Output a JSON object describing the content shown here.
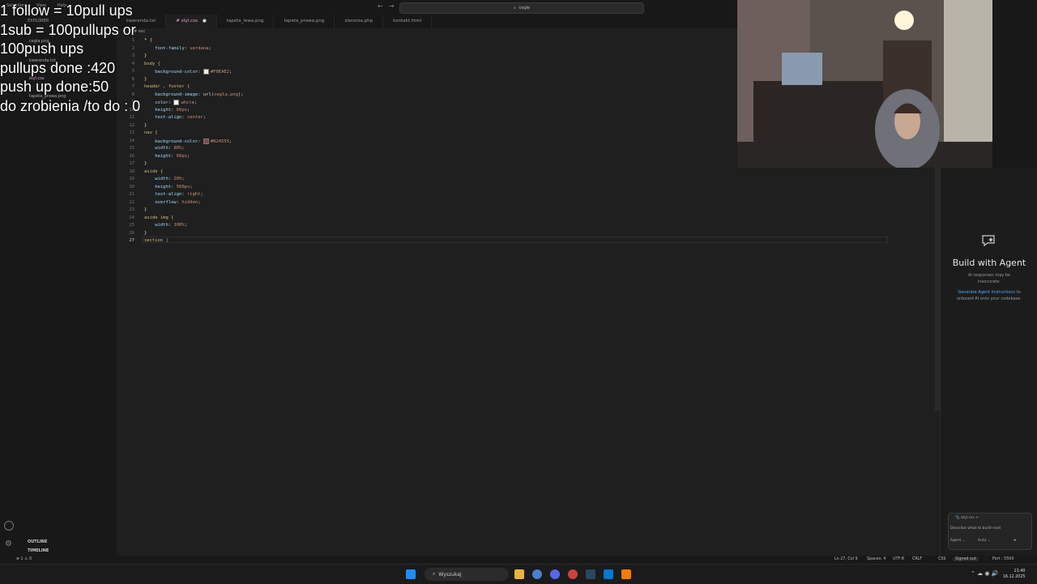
{
  "overlay": {
    "lines": [
      "1 follow = 10pull ups",
      "1sub = 100pullups or",
      "100push ups",
      "pullups done :420",
      "push up done:50",
      "do zrobienia /to do : 0"
    ]
  },
  "titlebar": {
    "search": "cegle",
    "menu": [
      "Selection",
      "View",
      "Help"
    ]
  },
  "sidebar": {
    "title": "EXPLORER",
    "items": [
      "cegla.png",
      "kwerenda.txt",
      "styl.css",
      "tapeta_prawa.png"
    ],
    "outline": "OUTLINE",
    "timeline": "TIMELINE"
  },
  "tabs": [
    {
      "label": "kwerenda.txt"
    },
    {
      "label": "# styl.css",
      "dirty": "●"
    },
    {
      "label": "tapeta_lewa.png"
    },
    {
      "label": "tapeta_prawa.png"
    },
    {
      "label": "zlecenia.php"
    },
    {
      "label": "kontakt.html"
    }
  ],
  "breadcrumb": "# sec",
  "editor": {
    "lines": [
      {
        "n": "1",
        "parts": [
          {
            "t": "* {",
            "c": "br"
          }
        ]
      },
      {
        "n": "2",
        "parts": [
          {
            "t": "    font-family",
            "c": "prop"
          },
          {
            "t": ": ",
            "c": ""
          },
          {
            "t": "verdana",
            "c": "val"
          },
          {
            "t": ";",
            "c": ""
          }
        ]
      },
      {
        "n": "3",
        "parts": [
          {
            "t": "}",
            "c": "br"
          }
        ]
      },
      {
        "n": "4",
        "parts": [
          {
            "t": "body {",
            "c": "sel"
          }
        ]
      },
      {
        "n": "5",
        "parts": [
          {
            "t": "    background-color",
            "c": "prop"
          },
          {
            "t": ": ",
            "c": ""
          },
          {
            "sw": "#F0EAE2"
          },
          {
            "t": "#F0EAE2",
            "c": "val"
          },
          {
            "t": ";",
            "c": ""
          }
        ]
      },
      {
        "n": "6",
        "parts": [
          {
            "t": "}",
            "c": "br"
          }
        ]
      },
      {
        "n": "7",
        "parts": [
          {
            "t": "header , footer {",
            "c": "sel"
          }
        ]
      },
      {
        "n": "8",
        "parts": [
          {
            "t": "    background-image",
            "c": "prop"
          },
          {
            "t": ": url(",
            "c": ""
          },
          {
            "t": "cegla.png",
            "c": "val"
          },
          {
            "t": ");",
            "c": ""
          }
        ]
      },
      {
        "n": "9",
        "parts": [
          {
            "t": "    color",
            "c": "prop"
          },
          {
            "t": ": ",
            "c": ""
          },
          {
            "sw": "#ffffff"
          },
          {
            "t": "white",
            "c": "val"
          },
          {
            "t": ";",
            "c": ""
          }
        ]
      },
      {
        "n": "10",
        "parts": [
          {
            "t": "    height",
            "c": "prop"
          },
          {
            "t": ": ",
            "c": ""
          },
          {
            "t": "60px",
            "c": "val"
          },
          {
            "t": ";",
            "c": ""
          }
        ]
      },
      {
        "n": "11",
        "parts": [
          {
            "t": "    text-align",
            "c": "prop"
          },
          {
            "t": ": ",
            "c": ""
          },
          {
            "t": "center",
            "c": "val"
          },
          {
            "t": ";",
            "c": ""
          }
        ]
      },
      {
        "n": "12",
        "parts": [
          {
            "t": "}",
            "c": "br"
          }
        ]
      },
      {
        "n": "13",
        "parts": [
          {
            "t": "nav {",
            "c": "sel"
          }
        ]
      },
      {
        "n": "14",
        "parts": [
          {
            "t": "    background-color",
            "c": "prop"
          },
          {
            "t": ": ",
            "c": ""
          },
          {
            "sw": "#824555"
          },
          {
            "t": "#824555",
            "c": "val"
          },
          {
            "t": ";",
            "c": ""
          }
        ]
      },
      {
        "n": "15",
        "parts": [
          {
            "t": "    width",
            "c": "prop"
          },
          {
            "t": ": ",
            "c": ""
          },
          {
            "t": "80%",
            "c": "val"
          },
          {
            "t": ";",
            "c": ""
          }
        ]
      },
      {
        "n": "16",
        "parts": [
          {
            "t": "    height",
            "c": "prop"
          },
          {
            "t": ": ",
            "c": ""
          },
          {
            "t": "60px",
            "c": "val"
          },
          {
            "t": ";",
            "c": ""
          }
        ]
      },
      {
        "n": "17",
        "parts": [
          {
            "t": "}",
            "c": "br"
          }
        ]
      },
      {
        "n": "18",
        "parts": [
          {
            "t": "aside {",
            "c": "sel"
          }
        ]
      },
      {
        "n": "19",
        "parts": [
          {
            "t": "    width",
            "c": "prop"
          },
          {
            "t": ": ",
            "c": ""
          },
          {
            "t": "20%",
            "c": "val"
          },
          {
            "t": ";",
            "c": ""
          }
        ]
      },
      {
        "n": "20",
        "parts": [
          {
            "t": "    height",
            "c": "prop"
          },
          {
            "t": ": ",
            "c": ""
          },
          {
            "t": "560px",
            "c": "val"
          },
          {
            "t": ";",
            "c": ""
          }
        ]
      },
      {
        "n": "21",
        "parts": [
          {
            "t": "    text-align",
            "c": "prop"
          },
          {
            "t": ": ",
            "c": ""
          },
          {
            "t": "right",
            "c": "val"
          },
          {
            "t": ";",
            "c": ""
          }
        ]
      },
      {
        "n": "22",
        "parts": [
          {
            "t": "    overflow",
            "c": "prop"
          },
          {
            "t": ": ",
            "c": ""
          },
          {
            "t": "hidden",
            "c": "val"
          },
          {
            "t": ";",
            "c": ""
          }
        ]
      },
      {
        "n": "23",
        "parts": [
          {
            "t": "}",
            "c": "br"
          }
        ]
      },
      {
        "n": "24",
        "parts": [
          {
            "t": "aside img {",
            "c": "sel"
          }
        ]
      },
      {
        "n": "25",
        "parts": [
          {
            "t": "    width",
            "c": "prop"
          },
          {
            "t": ": ",
            "c": ""
          },
          {
            "t": "100%",
            "c": "val"
          },
          {
            "t": ";",
            "c": ""
          }
        ]
      },
      {
        "n": "26",
        "parts": [
          {
            "t": "}",
            "c": "br"
          }
        ]
      },
      {
        "n": "27",
        "parts": [
          {
            "t": "section |",
            "c": "sel"
          }
        ]
      }
    ]
  },
  "agent": {
    "title": "Build with Agent",
    "sub1": "AI responses may be",
    "sub2": "inaccurate.",
    "link": "Generate Agent Instructions",
    "link_suffix": "to",
    "line3": "onboard AI onto your codebase.",
    "chat_file": "styl.css",
    "chat_placeholder": "Describe what to build next",
    "chat_mode": "Agent",
    "chat_model": "Auto"
  },
  "statusbar": {
    "left": "⊗ 1 ⚠ 0",
    "position": "Ln 27, Col 9",
    "spaces": "Spaces: 4",
    "encoding": "UTF-8",
    "eol": "CRLF",
    "lang": "CSS",
    "signed": "Signed out",
    "port": "Port : 5500"
  },
  "taskbar": {
    "search": "Wyszukaj",
    "time": "21:40",
    "date": "16.12.2025"
  },
  "colors": {
    "accent": "#0078d4",
    "tab_active": "#e0a4d8"
  }
}
